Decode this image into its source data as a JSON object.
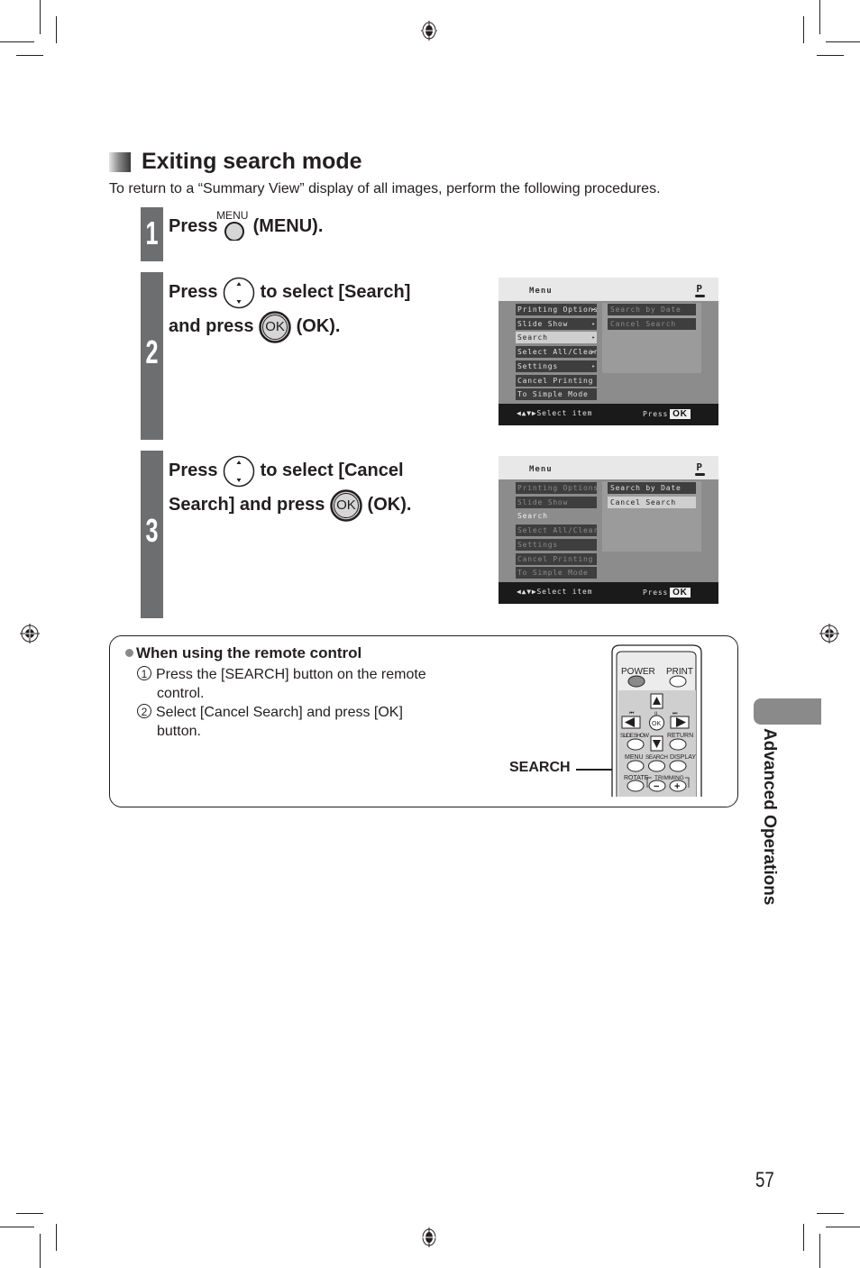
{
  "section": {
    "title": "Exiting search mode",
    "intro": "To return to a “Summary View” display of all images, perform the following procedures."
  },
  "steps": [
    {
      "number": "1",
      "parts": [
        "Press",
        "(MENU)."
      ],
      "button_caption": "MENU",
      "icon": "menu-button-icon"
    },
    {
      "number": "2",
      "line1": [
        "Press",
        "to select [Search]"
      ],
      "line2": [
        "and press",
        "(OK)."
      ],
      "icon_nav": "up-down-button-icon",
      "icon_ok": "ok-button-icon",
      "ok_glyph": "OK"
    },
    {
      "number": "3",
      "line1": [
        "Press",
        "to select [Cancel"
      ],
      "line2": [
        "Search] and press",
        "(OK)."
      ],
      "icon_nav": "up-down-button-icon",
      "icon_ok": "ok-button-icon",
      "ok_glyph": "OK"
    }
  ],
  "screens": [
    {
      "title": "Menu",
      "mode_badge": "P",
      "menu_items": [
        {
          "label": "Printing Options",
          "arrow": "▸",
          "state": "normal"
        },
        {
          "label": "Slide Show",
          "arrow": "▸",
          "state": "normal"
        },
        {
          "label": "Search",
          "arrow": "▸",
          "state": "selected"
        },
        {
          "label": "Select All/Clear",
          "arrow": "▸",
          "state": "normal"
        },
        {
          "label": "Settings",
          "arrow": "▸",
          "state": "normal"
        },
        {
          "label": "Cancel Printing",
          "arrow": "",
          "state": "normal"
        },
        {
          "label": "To Simple Mode",
          "arrow": "",
          "state": "normal"
        }
      ],
      "submenu_items": [
        {
          "label": "Search by Date",
          "state": "dim"
        },
        {
          "label": "Cancel Search",
          "state": "dim"
        }
      ],
      "footer_nav": "◀▲▼▶Select item",
      "footer_press": "Press",
      "footer_ok": "OK"
    },
    {
      "title": "Menu",
      "mode_badge": "P",
      "menu_items": [
        {
          "label": "Printing Options",
          "arrow": "",
          "state": "dim"
        },
        {
          "label": "Slide Show",
          "arrow": "",
          "state": "dim"
        },
        {
          "label": "Search",
          "arrow": "",
          "state": "active"
        },
        {
          "label": "Select All/Clear",
          "arrow": "",
          "state": "dim"
        },
        {
          "label": "Settings",
          "arrow": "",
          "state": "dim"
        },
        {
          "label": "Cancel Printing",
          "arrow": "",
          "state": "dim"
        },
        {
          "label": "To Simple Mode",
          "arrow": "",
          "state": "dim"
        }
      ],
      "submenu_items": [
        {
          "label": "Search by Date",
          "state": "normal"
        },
        {
          "label": "Cancel Search",
          "state": "selected"
        }
      ],
      "footer_nav": "◀▲▼▶Select item",
      "footer_press": "Press",
      "footer_ok": "OK"
    }
  ],
  "remote_note": {
    "heading": "When using the remote control",
    "items": [
      {
        "num": "1",
        "lines": [
          "Press the [SEARCH] button on the remote",
          "control."
        ]
      },
      {
        "num": "2",
        "lines": [
          "Select [Cancel Search] and press [OK]",
          "button."
        ]
      }
    ],
    "callout": "SEARCH",
    "remote_labels": {
      "power": "POWER",
      "print": "PRINT",
      "ok": "OK",
      "slide_show": "SLIDE SHOW",
      "return": "RETURN",
      "menu": "MENU",
      "search": "SEARCH",
      "display": "DISPLAY",
      "rotate": "ROTATE",
      "trimming": "TRIMMING",
      "minus": "−",
      "plus": "+",
      "prev": "⏮",
      "pause": "II",
      "next": "⏭"
    }
  },
  "side_tab": {
    "label": "Advanced Operations"
  },
  "page_number": "57"
}
